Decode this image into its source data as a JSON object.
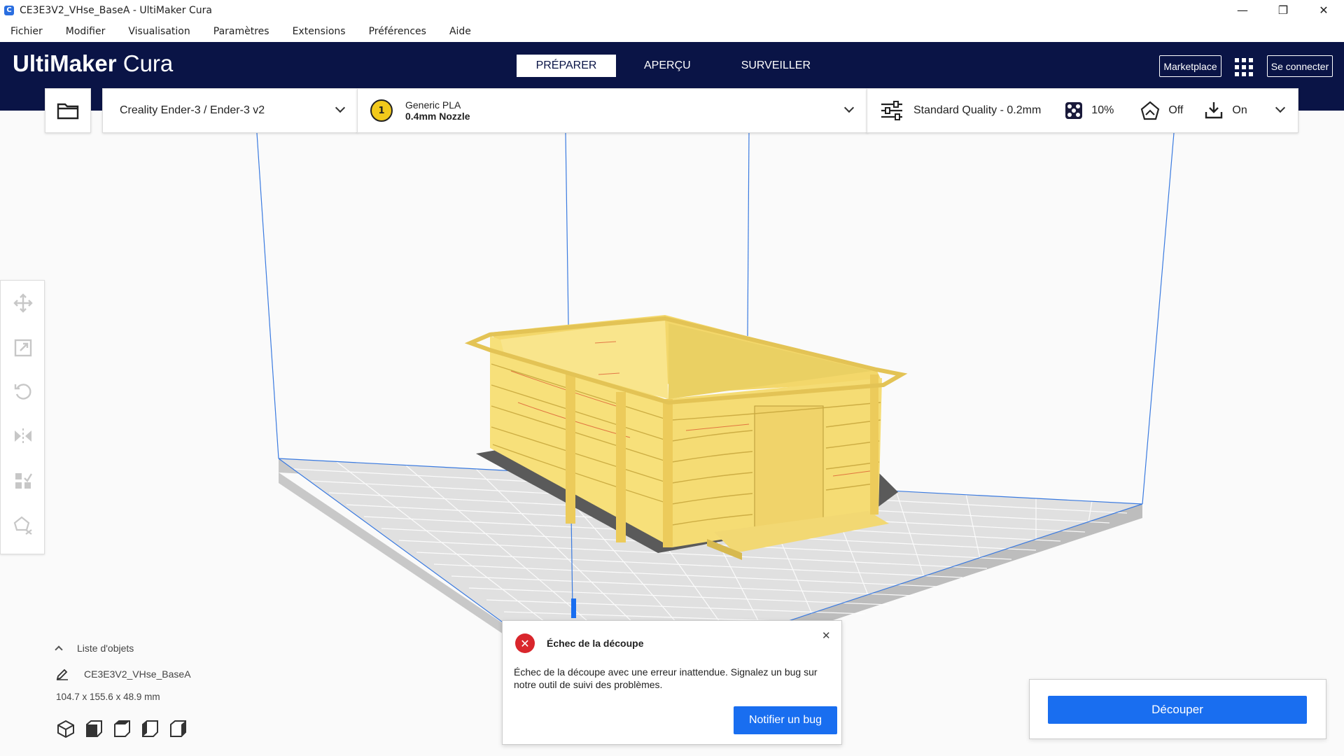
{
  "window": {
    "title": "CE3E3V2_VHse_BaseA - UltiMaker Cura",
    "app_icon_letter": "C",
    "controls": {
      "minimize": "—",
      "restore": "❐",
      "close": "✕"
    }
  },
  "menu": [
    "Fichier",
    "Modifier",
    "Visualisation",
    "Paramètres",
    "Extensions",
    "Préférences",
    "Aide"
  ],
  "header": {
    "logo_bold": "UltiMaker",
    "logo_light": "Cura",
    "tabs": [
      "PRÉPARER",
      "APERÇU",
      "SURVEILLER"
    ],
    "active_tab": "PRÉPARER",
    "marketplace_label": "Marketplace",
    "login_label": "Se connecter"
  },
  "toolbar": {
    "printer": "Creality Ender-3 / Ender-3 v2",
    "extruder_number": "1",
    "material": "Generic PLA",
    "nozzle": "0.4mm Nozzle",
    "quality": "Standard Quality - 0.2mm",
    "infill": "10%",
    "support": "Off",
    "adhesion": "On"
  },
  "object_list": {
    "title": "Liste d'objets",
    "object_name": "CE3E3V2_VHse_BaseA",
    "dimensions": "104.7 x 155.6 x 48.9 mm"
  },
  "toast": {
    "title": "Échec de la découpe",
    "message": "Échec de la découpe avec une erreur inattendue. Signalez un bug sur notre outil de suivi des problèmes.",
    "button_label": "Notifier un bug",
    "close_glyph": "✕"
  },
  "slice": {
    "button_label": "Découper"
  },
  "colors": {
    "header_bg": "#0a1446",
    "accent_blue": "#196ef0",
    "error_red": "#d9262c",
    "model_yellow": "#f7e07a",
    "model_shadow": "#d4b94a",
    "extruder_yellow": "#f2c91b"
  }
}
